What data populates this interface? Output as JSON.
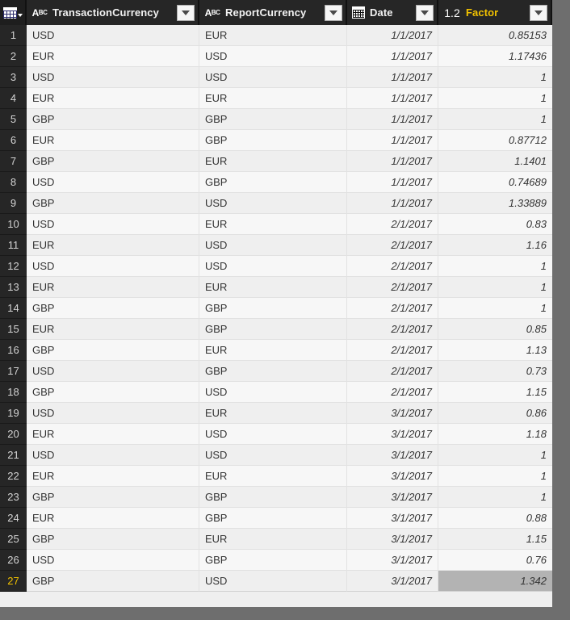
{
  "grid": {
    "corner": {
      "icon": "table-icon",
      "caret": "chevron-down-icon"
    },
    "columns": [
      {
        "label": "TransactionCurrency",
        "type_icon": "abc-text-icon",
        "accent": false,
        "align": "left"
      },
      {
        "label": "ReportCurrency",
        "type_icon": "abc-text-icon",
        "accent": false,
        "align": "left"
      },
      {
        "label": "Date",
        "type_icon": "calendar-icon",
        "accent": false,
        "align": "right"
      },
      {
        "label": "Factor",
        "type_icon": "decimal-number-icon",
        "accent": true,
        "align": "right"
      }
    ],
    "filter_icon": "filter-dropdown-icon",
    "accent_color": "#f2c200",
    "selected_row": 27,
    "selected_column": "Factor",
    "row_count": 27,
    "rows": [
      {
        "n": "1",
        "TransactionCurrency": "USD",
        "ReportCurrency": "EUR",
        "Date": "1/1/2017",
        "Factor": "0.85153"
      },
      {
        "n": "2",
        "TransactionCurrency": "EUR",
        "ReportCurrency": "USD",
        "Date": "1/1/2017",
        "Factor": "1.17436"
      },
      {
        "n": "3",
        "TransactionCurrency": "USD",
        "ReportCurrency": "USD",
        "Date": "1/1/2017",
        "Factor": "1"
      },
      {
        "n": "4",
        "TransactionCurrency": "EUR",
        "ReportCurrency": "EUR",
        "Date": "1/1/2017",
        "Factor": "1"
      },
      {
        "n": "5",
        "TransactionCurrency": "GBP",
        "ReportCurrency": "GBP",
        "Date": "1/1/2017",
        "Factor": "1"
      },
      {
        "n": "6",
        "TransactionCurrency": "EUR",
        "ReportCurrency": "GBP",
        "Date": "1/1/2017",
        "Factor": "0.87712"
      },
      {
        "n": "7",
        "TransactionCurrency": "GBP",
        "ReportCurrency": "EUR",
        "Date": "1/1/2017",
        "Factor": "1.1401"
      },
      {
        "n": "8",
        "TransactionCurrency": "USD",
        "ReportCurrency": "GBP",
        "Date": "1/1/2017",
        "Factor": "0.74689"
      },
      {
        "n": "9",
        "TransactionCurrency": "GBP",
        "ReportCurrency": "USD",
        "Date": "1/1/2017",
        "Factor": "1.33889"
      },
      {
        "n": "10",
        "TransactionCurrency": "USD",
        "ReportCurrency": "EUR",
        "Date": "2/1/2017",
        "Factor": "0.83"
      },
      {
        "n": "11",
        "TransactionCurrency": "EUR",
        "ReportCurrency": "USD",
        "Date": "2/1/2017",
        "Factor": "1.16"
      },
      {
        "n": "12",
        "TransactionCurrency": "USD",
        "ReportCurrency": "USD",
        "Date": "2/1/2017",
        "Factor": "1"
      },
      {
        "n": "13",
        "TransactionCurrency": "EUR",
        "ReportCurrency": "EUR",
        "Date": "2/1/2017",
        "Factor": "1"
      },
      {
        "n": "14",
        "TransactionCurrency": "GBP",
        "ReportCurrency": "GBP",
        "Date": "2/1/2017",
        "Factor": "1"
      },
      {
        "n": "15",
        "TransactionCurrency": "EUR",
        "ReportCurrency": "GBP",
        "Date": "2/1/2017",
        "Factor": "0.85"
      },
      {
        "n": "16",
        "TransactionCurrency": "GBP",
        "ReportCurrency": "EUR",
        "Date": "2/1/2017",
        "Factor": "1.13"
      },
      {
        "n": "17",
        "TransactionCurrency": "USD",
        "ReportCurrency": "GBP",
        "Date": "2/1/2017",
        "Factor": "0.73"
      },
      {
        "n": "18",
        "TransactionCurrency": "GBP",
        "ReportCurrency": "USD",
        "Date": "2/1/2017",
        "Factor": "1.15"
      },
      {
        "n": "19",
        "TransactionCurrency": "USD",
        "ReportCurrency": "EUR",
        "Date": "3/1/2017",
        "Factor": "0.86"
      },
      {
        "n": "20",
        "TransactionCurrency": "EUR",
        "ReportCurrency": "USD",
        "Date": "3/1/2017",
        "Factor": "1.18"
      },
      {
        "n": "21",
        "TransactionCurrency": "USD",
        "ReportCurrency": "USD",
        "Date": "3/1/2017",
        "Factor": "1"
      },
      {
        "n": "22",
        "TransactionCurrency": "EUR",
        "ReportCurrency": "EUR",
        "Date": "3/1/2017",
        "Factor": "1"
      },
      {
        "n": "23",
        "TransactionCurrency": "GBP",
        "ReportCurrency": "GBP",
        "Date": "3/1/2017",
        "Factor": "1"
      },
      {
        "n": "24",
        "TransactionCurrency": "EUR",
        "ReportCurrency": "GBP",
        "Date": "3/1/2017",
        "Factor": "0.88"
      },
      {
        "n": "25",
        "TransactionCurrency": "GBP",
        "ReportCurrency": "EUR",
        "Date": "3/1/2017",
        "Factor": "1.15"
      },
      {
        "n": "26",
        "TransactionCurrency": "USD",
        "ReportCurrency": "GBP",
        "Date": "3/1/2017",
        "Factor": "0.76"
      },
      {
        "n": "27",
        "TransactionCurrency": "GBP",
        "ReportCurrency": "USD",
        "Date": "3/1/2017",
        "Factor": "1.342"
      }
    ]
  }
}
